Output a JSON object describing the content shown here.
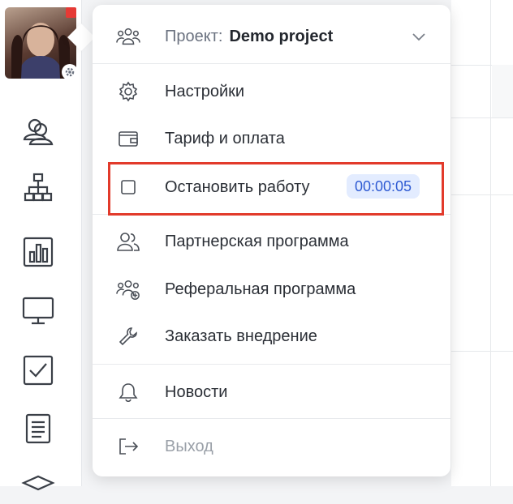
{
  "project": {
    "prefix": "Проект:",
    "name": "Demo project"
  },
  "menu_items": [
    {
      "label": "Настройки"
    },
    {
      "label": "Тариф и оплата"
    },
    {
      "label": "Остановить работу",
      "timer": "00:00:05"
    },
    {
      "label": "Партнерская программа"
    },
    {
      "label": "Реферальная программа"
    },
    {
      "label": "Заказать внедрение"
    },
    {
      "label": "Новости"
    },
    {
      "label": "Выход"
    }
  ],
  "colors": {
    "highlight": "#e23a2b",
    "timer_bg": "#e3ecff",
    "timer_text": "#2f5bd3",
    "notification": "#e53a35"
  },
  "icons": [
    "team-icon",
    "gear-icon",
    "wallet-icon",
    "checkbox-icon",
    "partners-icon",
    "referral-icon",
    "wrench-icon",
    "bell-icon",
    "logout-icon",
    "chevron-down-icon"
  ]
}
